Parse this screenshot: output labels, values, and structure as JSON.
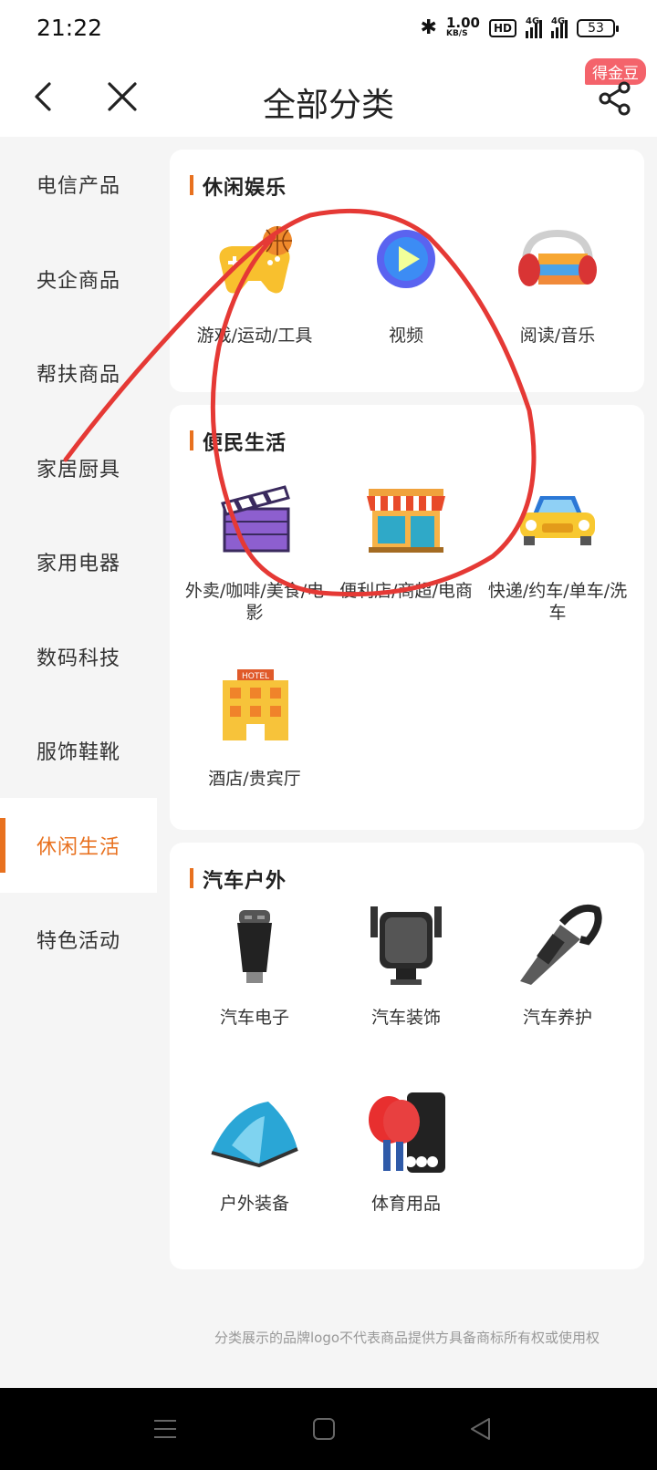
{
  "status_bar": {
    "time": "21:22",
    "speed": "1.00",
    "speed_unit": "KB/S",
    "hd": "HD",
    "net1": "4G",
    "net2": "4G",
    "battery": "53"
  },
  "header": {
    "title": "全部分类",
    "badge": "得金豆",
    "icons": [
      "back-arrow-icon",
      "close-icon",
      "share-icon"
    ]
  },
  "sidebar": {
    "items": [
      {
        "label": "电信产品"
      },
      {
        "label": "央企商品"
      },
      {
        "label": "帮扶商品"
      },
      {
        "label": "家居厨具"
      },
      {
        "label": "家用电器"
      },
      {
        "label": "数码科技"
      },
      {
        "label": "服饰鞋靴"
      },
      {
        "label": "休闲生活",
        "active": true
      },
      {
        "label": "特色活动"
      }
    ]
  },
  "sections": [
    {
      "title": "休闲娱乐",
      "items": [
        {
          "label": "游戏/运动/工具",
          "icon": "gamepad-basketball-icon"
        },
        {
          "label": "视频",
          "icon": "play-video-icon"
        },
        {
          "label": "阅读/音乐",
          "icon": "books-headphones-icon"
        }
      ]
    },
    {
      "title": "便民生活",
      "items": [
        {
          "label": "外卖/咖啡/美食/电影",
          "icon": "clapperboard-icon"
        },
        {
          "label": "便利店/商超/电商",
          "icon": "storefront-icon"
        },
        {
          "label": "快递/约车/单车/洗车",
          "icon": "car-icon"
        },
        {
          "label": "酒店/贵宾厅",
          "icon": "hotel-icon"
        }
      ]
    },
    {
      "title": "汽车户外",
      "items": [
        {
          "label": "汽车电子",
          "icon": "car-charger-icon"
        },
        {
          "label": "汽车装饰",
          "icon": "phone-holder-icon"
        },
        {
          "label": "汽车养护",
          "icon": "car-vacuum-icon"
        },
        {
          "label": "户外装备",
          "icon": "tent-icon"
        },
        {
          "label": "体育用品",
          "icon": "ping-pong-icon"
        }
      ]
    }
  ],
  "footnote": "分类展示的品牌logo不代表商品提供方具备商标所有权或使用权",
  "colors": {
    "accent": "#e8711f",
    "badge": "#f4636b",
    "annotation": "#e53935"
  }
}
